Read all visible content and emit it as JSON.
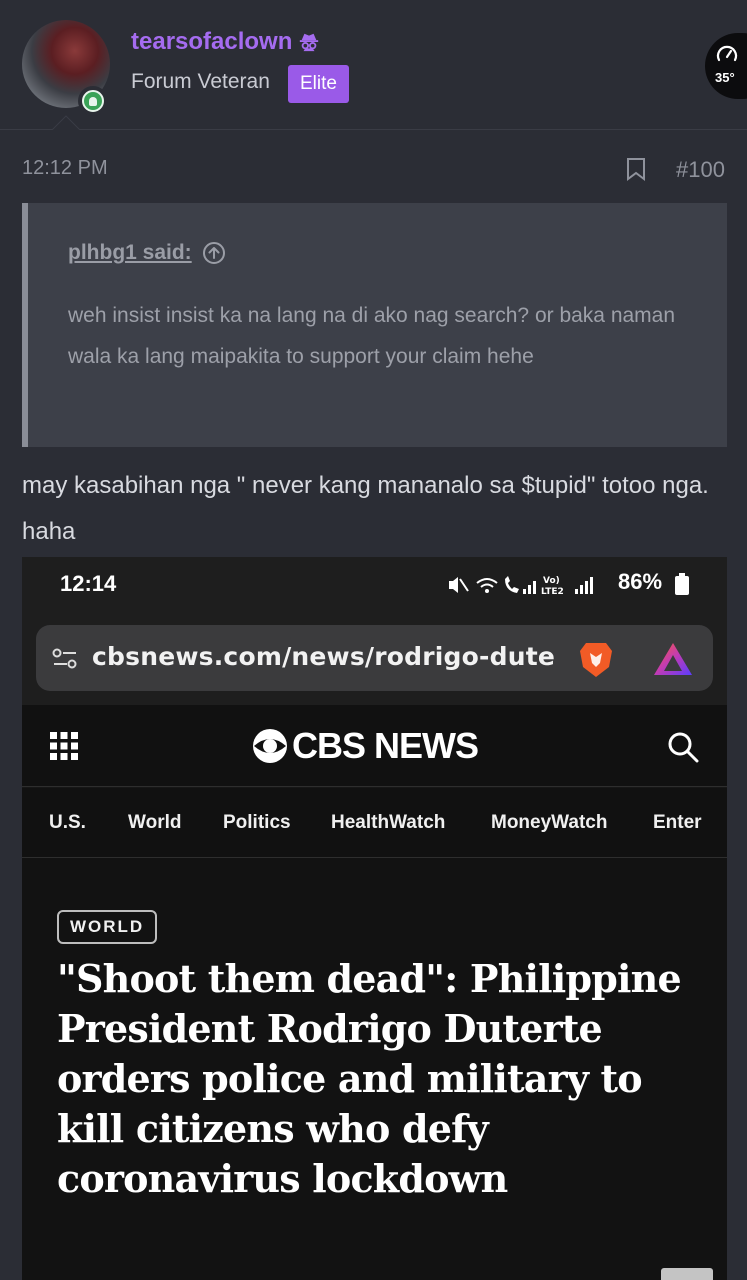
{
  "author": {
    "username": "tearsofaclown",
    "title": "Forum Veteran",
    "badge": "Elite",
    "username_color": "#a56cf0",
    "badge_color": "#9a5ae8",
    "online_color": "#3aa357"
  },
  "speed_widget": {
    "temperature": "35°"
  },
  "post": {
    "time": "12:12 PM",
    "number": "#100",
    "quote": {
      "author": "plhbg1 said:",
      "text": "weh insist insist ka na lang na di ako nag search? or baka naman wala ka lang maipakita to support your claim hehe"
    },
    "body": "may kasabihan nga \" never kang mananalo sa $tupid\" totoo nga. haha"
  },
  "screenshot": {
    "status_time": "12:14",
    "battery": "86%",
    "network_label_top": "Vo)",
    "network_label_bottom": "LTE2",
    "url": "cbsnews.com/news/rodrigo-dute",
    "site_logo": "CBS NEWS",
    "nav": [
      "U.S.",
      "World",
      "Politics",
      "HealthWatch",
      "MoneyWatch",
      "Enter"
    ],
    "section": "WORLD",
    "headline": "\"Shoot them dead\": Philippine President Rodrigo Duterte orders police and military to kill citizens who defy coronavirus lockdown"
  }
}
